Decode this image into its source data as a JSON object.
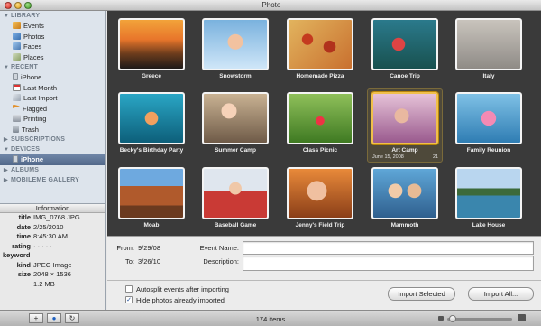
{
  "window": {
    "title": "iPhoto"
  },
  "sidebar": {
    "library_heading": "LIBRARY",
    "library_items": [
      "Events",
      "Photos",
      "Faces",
      "Places"
    ],
    "recent_heading": "RECENT",
    "recent_items": [
      "iPhone",
      "Last Month",
      "Last Import",
      "Flagged",
      "Printing",
      "Trash"
    ],
    "subscriptions_heading": "SUBSCRIPTIONS",
    "devices_heading": "DEVICES",
    "device_selected": "iPhone",
    "albums_heading": "ALBUMS",
    "gallery_heading": "MOBILEME GALLERY"
  },
  "info": {
    "heading": "Information",
    "title_label": "title",
    "title_value": "IMG_0768.JPG",
    "date_label": "date",
    "date_value": "2/25/2010",
    "time_label": "time",
    "time_value": "8:45:30 AM",
    "rating_label": "rating",
    "rating_value": "· · · · ·",
    "keyword_label": "keyword",
    "kind_label": "kind",
    "kind_value": "JPEG Image",
    "size_label": "size",
    "size_value": "2048 × 1536",
    "filesize_value": "1.2 MB"
  },
  "thumbnails": [
    "Greece",
    "Snowstorm",
    "Homemade Pizza",
    "Canoe Trip",
    "Italy",
    "Becky's Birthday Party",
    "Summer Camp",
    "Class Picnic",
    "Art Camp",
    "Family Reunion",
    "Moab",
    "Baseball Game",
    "Jenny's Field Trip",
    "Mammoth",
    "Lake House"
  ],
  "selected_thumb": {
    "date": "June 15, 2008",
    "count": "21"
  },
  "form": {
    "from_label": "From:",
    "from_value": "9/29/08",
    "to_label": "To:",
    "to_value": "3/26/10",
    "event_name_label": "Event Name:",
    "description_label": "Description:",
    "autosplit_label": "Autosplit events after importing",
    "autosplit_checked": false,
    "hide_label": "Hide photos already imported",
    "hide_checked": true,
    "import_selected": "Import Selected",
    "import_all": "Import All..."
  },
  "bottombar": {
    "add_button": "+",
    "item_count": "174 items",
    "zoom_fraction": 0.08
  }
}
